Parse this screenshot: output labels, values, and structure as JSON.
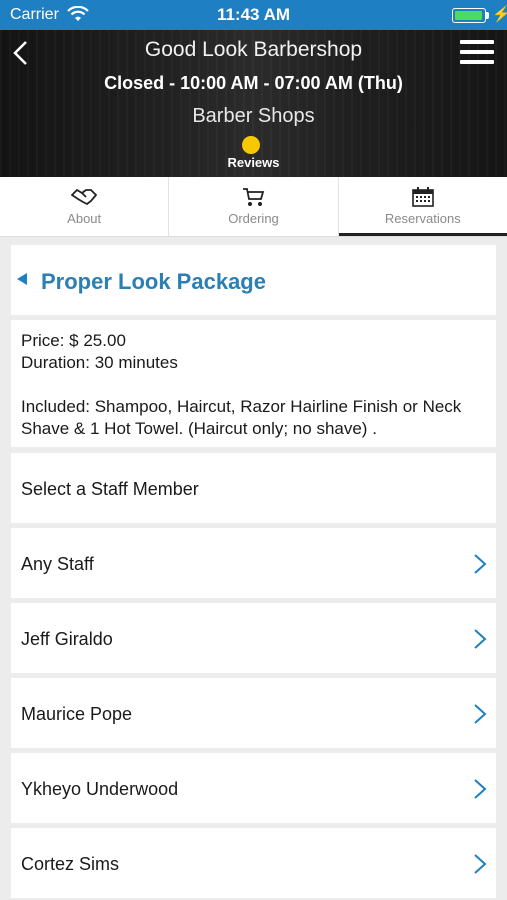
{
  "status_bar": {
    "carrier": "Carrier",
    "time": "11:43 AM"
  },
  "header": {
    "title": "Good Look Barbershop",
    "hours": "Closed - 10:00 AM - 07:00 AM (Thu)",
    "category": "Barber Shops",
    "reviews_label": "Reviews"
  },
  "tabs": [
    {
      "label": "About",
      "icon": "handshake-icon"
    },
    {
      "label": "Ordering",
      "icon": "cart-icon"
    },
    {
      "label": "Reservations",
      "icon": "calendar-icon",
      "active": true
    }
  ],
  "package": {
    "title": "Proper Look Package",
    "price": "Price: $ 25.00",
    "duration": "Duration: 30 minutes",
    "included": "Included: Shampoo, Haircut, Razor Hairline Finish or Neck Shave & 1 Hot Towel. (Haircut only; no shave) ."
  },
  "staff_section": {
    "heading": "Select a Staff Member"
  },
  "staff": [
    "Any Staff",
    "Jeff Giraldo",
    "Maurice Pope",
    "Ykheyo Underwood",
    "Cortez Sims"
  ],
  "colors": {
    "accent": "#1e7fc2",
    "title_blue": "#2a7fb5",
    "background": "#ececec"
  }
}
